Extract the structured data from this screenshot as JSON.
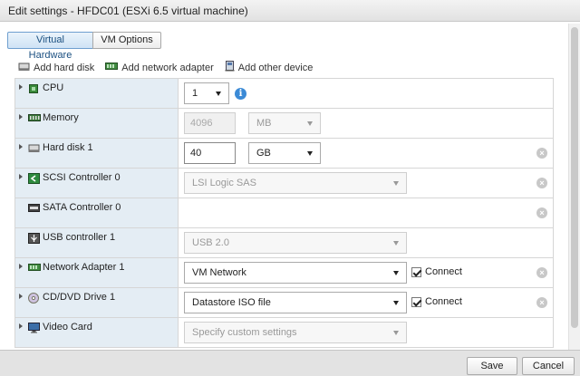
{
  "window": {
    "title": "Edit settings - HFDC01 (ESXi 6.5 virtual machine)"
  },
  "tabs": [
    {
      "label": "Virtual Hardware",
      "active": true
    },
    {
      "label": "VM Options",
      "active": false
    }
  ],
  "toolbar": {
    "add_hard_disk": {
      "label": "Add hard disk",
      "icon": "hard-disk-icon"
    },
    "add_network_adapter": {
      "label": "Add network adapter",
      "icon": "network-adapter-icon"
    },
    "add_other_device": {
      "label": "Add other device",
      "icon": "device-icon"
    }
  },
  "devices": {
    "cpu": {
      "label": "CPU",
      "value": "1"
    },
    "memory": {
      "label": "Memory",
      "value": "4096",
      "unit": "MB"
    },
    "hard_disk": {
      "label": "Hard disk 1",
      "value": "40",
      "unit": "GB"
    },
    "scsi": {
      "label": "SCSI Controller 0",
      "value": "LSI Logic SAS"
    },
    "sata": {
      "label": "SATA Controller 0"
    },
    "usb": {
      "label": "USB controller 1",
      "value": "USB 2.0"
    },
    "network": {
      "label": "Network Adapter 1",
      "value": "VM Network",
      "connect_label": "Connect",
      "connected": true
    },
    "cdrom": {
      "label": "CD/DVD Drive 1",
      "value": "Datastore ISO file",
      "connect_label": "Connect",
      "connected": true
    },
    "video": {
      "label": "Video Card",
      "value": "Specify custom settings"
    }
  },
  "footer": {
    "save_label": "Save",
    "cancel_label": "Cancel"
  },
  "colors": {
    "tab_active": "#cfe3f5",
    "label_column": "#e4edf4",
    "info": "#3b8ad6"
  }
}
